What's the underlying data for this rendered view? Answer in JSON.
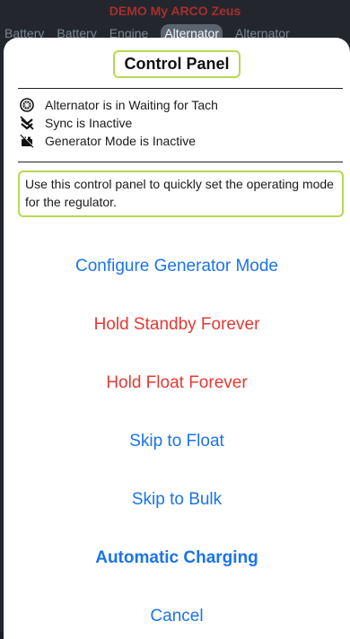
{
  "background": {
    "app_title": "DEMO My ARCO Zeus",
    "tabs": [
      {
        "label": "Battery",
        "active": false
      },
      {
        "label": "Battery",
        "active": false
      },
      {
        "label": "Engine",
        "active": false
      },
      {
        "label": "Alternator",
        "active": true
      },
      {
        "label": "Alternator",
        "active": false
      }
    ]
  },
  "sheet": {
    "title": "Control Panel",
    "status": [
      {
        "icon": "alternator-icon",
        "text": "Alternator is in Waiting for Tach"
      },
      {
        "icon": "sync-off-icon",
        "text": "Sync is Inactive"
      },
      {
        "icon": "generator-off-icon",
        "text": "Generator Mode is Inactive"
      }
    ],
    "description": "Use this control panel to quickly set the operating mode for the regulator.",
    "actions": [
      {
        "label": "Configure Generator Mode",
        "color": "#1b74e8",
        "bold": false
      },
      {
        "label": "Hold Standby Forever",
        "color": "#e53935",
        "bold": false
      },
      {
        "label": "Hold Float Forever",
        "color": "#e53935",
        "bold": false
      },
      {
        "label": "Skip to Float",
        "color": "#1b74e8",
        "bold": false
      },
      {
        "label": "Skip to Bulk",
        "color": "#1b74e8",
        "bold": false
      },
      {
        "label": "Automatic Charging",
        "color": "#1b74e8",
        "bold": true
      },
      {
        "label": "Cancel",
        "color": "#1b74e8",
        "bold": false
      }
    ]
  },
  "colors": {
    "link_blue": "#1b74e8",
    "danger_red": "#e53935",
    "highlight_green": "#b7d957"
  }
}
